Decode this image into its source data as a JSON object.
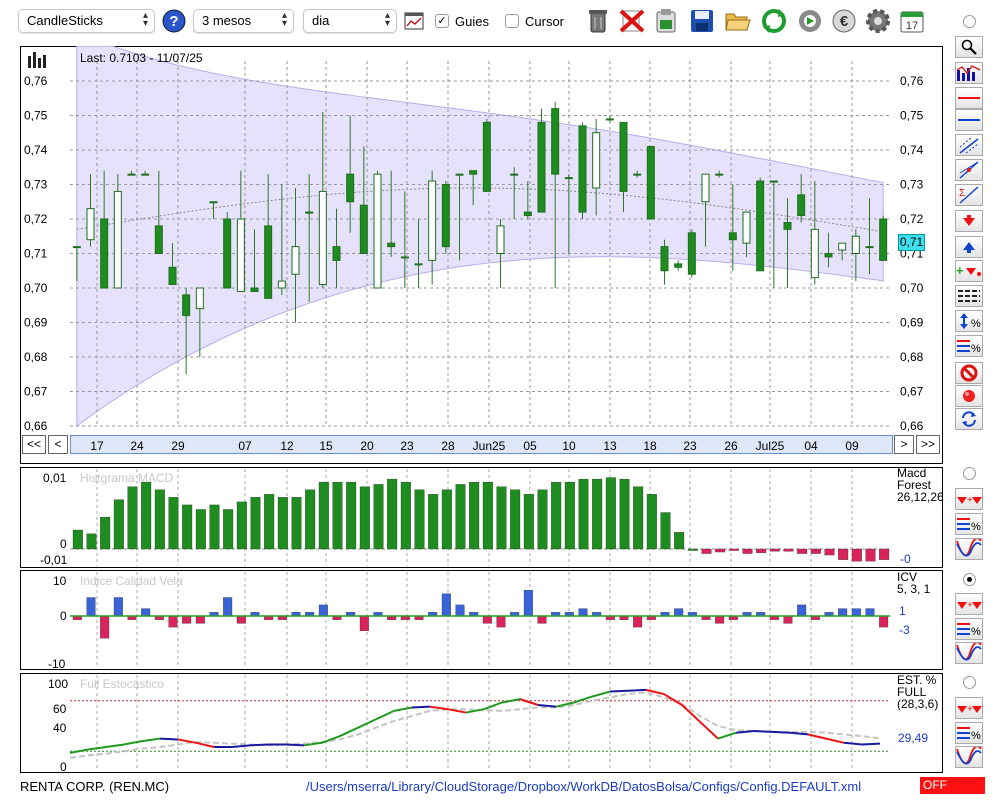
{
  "toolbar": {
    "chart_type": "CandleSticks",
    "period": "3 mesos",
    "interval": "dia",
    "guides_label": "Guies",
    "guides_checked": true,
    "cursor_label": "Cursor",
    "cursor_checked": false,
    "icons": [
      "help-icon",
      "chart-window-icon",
      "trash-icon",
      "delete-red-x-icon",
      "clipboard-icon",
      "save-disk-icon",
      "open-folder-icon",
      "refresh-icon",
      "world-refresh-icon",
      "euro-icon",
      "gear-icon",
      "calendar-icon"
    ],
    "calendar_day": "17"
  },
  "main": {
    "last_label": "Last: 0.7103 - 11/07/25",
    "price_tag": "0,71",
    "y_ticks": [
      "0,76",
      "0,75",
      "0,74",
      "0,73",
      "0,72",
      "0,71",
      "0,70",
      "0,69",
      "0,68",
      "0,67",
      "0,66"
    ],
    "x_ticks": [
      "17",
      "24",
      "29",
      "07",
      "12",
      "15",
      "20",
      "23",
      "28",
      "Jun25",
      "05",
      "10",
      "13",
      "18",
      "23",
      "26",
      "Jul25",
      "04",
      "09"
    ],
    "nav": {
      "first": "<<",
      "prev": "<",
      "next": ">",
      "last": ">>"
    }
  },
  "macd": {
    "title": "Histgrama MACD",
    "y_ticks": [
      "0,01",
      "0",
      "-0,01"
    ],
    "legend": [
      "Macd",
      "Forest",
      "26,12,26"
    ],
    "value": "-0"
  },
  "icv": {
    "title": "Indice Calidad Vela",
    "y_ticks": [
      "10",
      "0",
      "-10"
    ],
    "legend": [
      "ICV",
      "5, 3, 1"
    ],
    "values": [
      "1",
      "-3"
    ]
  },
  "stoch": {
    "title": "Full Estocástico",
    "y_ticks": [
      "100",
      "60",
      "40",
      "0"
    ],
    "legend": [
      "EST. %",
      "FULL",
      "(28,3,6)"
    ],
    "value": "29,49"
  },
  "status": {
    "company": "RENTA CORP. (REN.MC)",
    "path": "/Users/mserra/Library/CloudStorage/Dropbox/WorkDB/DatosBolsa/Configs/Config.DEFAULT.xml",
    "badge": "OFF"
  },
  "colors": {
    "up": "#ffffff",
    "down": "#1f8c1f",
    "band": "#e3ddfa",
    "macd_pos": "#1f8c1f",
    "macd_neg": "#d8245a",
    "icv_pos": "#3a63d8",
    "icv_neg": "#d8245a",
    "badge_bg": "#f11"
  },
  "chart_data": [
    {
      "type": "candlestick",
      "y_ticks": [
        0.76,
        0.75,
        0.74,
        0.73,
        0.72,
        0.71,
        0.7,
        0.69,
        0.68,
        0.67,
        0.66
      ],
      "ylim": [
        0.66,
        0.765
      ],
      "x_ticks": [
        "17",
        "24",
        "29",
        "07",
        "12",
        "15",
        "20",
        "23",
        "28",
        "Jun25",
        "05",
        "10",
        "13",
        "18",
        "23",
        "26",
        "Jul25",
        "04",
        "09"
      ],
      "ohlc": [
        [
          0.712,
          0.712,
          0.702,
          0.712
        ],
        [
          0.714,
          0.733,
          0.712,
          0.723
        ],
        [
          0.72,
          0.734,
          0.704,
          0.7
        ],
        [
          0.7,
          0.733,
          0.71,
          0.728
        ],
        [
          0.733,
          0.734,
          0.733,
          0.733
        ],
        [
          0.733,
          0.734,
          0.733,
          0.733
        ],
        [
          0.718,
          0.734,
          0.71,
          0.71
        ],
        [
          0.706,
          0.713,
          0.701,
          0.701
        ],
        [
          0.698,
          0.7,
          0.675,
          0.692
        ],
        [
          0.694,
          0.7,
          0.68,
          0.7
        ],
        [
          0.725,
          0.725,
          0.72,
          0.725
        ],
        [
          0.72,
          0.722,
          0.7,
          0.7
        ],
        [
          0.699,
          0.734,
          0.699,
          0.72
        ],
        [
          0.7,
          0.717,
          0.699,
          0.699
        ],
        [
          0.718,
          0.733,
          0.698,
          0.697
        ],
        [
          0.7,
          0.73,
          0.698,
          0.702
        ],
        [
          0.704,
          0.729,
          0.69,
          0.712
        ],
        [
          0.722,
          0.733,
          0.696,
          0.722
        ],
        [
          0.701,
          0.751,
          0.7,
          0.728
        ],
        [
          0.712,
          0.723,
          0.7,
          0.708
        ],
        [
          0.733,
          0.75,
          0.716,
          0.725
        ],
        [
          0.724,
          0.741,
          0.716,
          0.71
        ],
        [
          0.7,
          0.734,
          0.706,
          0.733
        ],
        [
          0.713,
          0.734,
          0.709,
          0.712
        ],
        [
          0.709,
          0.728,
          0.7,
          0.709
        ],
        [
          0.707,
          0.72,
          0.7,
          0.707
        ],
        [
          0.708,
          0.734,
          0.701,
          0.731
        ],
        [
          0.73,
          0.731,
          0.71,
          0.712
        ],
        [
          0.733,
          0.733,
          0.708,
          0.733
        ],
        [
          0.734,
          0.734,
          0.724,
          0.733
        ],
        [
          0.748,
          0.749,
          0.728,
          0.728
        ],
        [
          0.71,
          0.72,
          0.7,
          0.718
        ],
        [
          0.733,
          0.735,
          0.72,
          0.733
        ],
        [
          0.722,
          0.731,
          0.72,
          0.721
        ],
        [
          0.748,
          0.752,
          0.722,
          0.722
        ],
        [
          0.752,
          0.754,
          0.7,
          0.733
        ],
        [
          0.732,
          0.733,
          0.71,
          0.732
        ],
        [
          0.747,
          0.748,
          0.72,
          0.722
        ],
        [
          0.729,
          0.749,
          0.721,
          0.745
        ],
        [
          0.749,
          0.75,
          0.748,
          0.749
        ],
        [
          0.748,
          0.748,
          0.722,
          0.728
        ],
        [
          0.733,
          0.734,
          0.732,
          0.733
        ],
        [
          0.741,
          0.741,
          0.72,
          0.72
        ],
        [
          0.712,
          0.714,
          0.701,
          0.705
        ],
        [
          0.707,
          0.708,
          0.705,
          0.706
        ],
        [
          0.716,
          0.717,
          0.703,
          0.704
        ],
        [
          0.725,
          0.733,
          0.712,
          0.733
        ],
        [
          0.733,
          0.734,
          0.732,
          0.733
        ],
        [
          0.716,
          0.73,
          0.705,
          0.714
        ],
        [
          0.713,
          0.721,
          0.709,
          0.722
        ],
        [
          0.731,
          0.732,
          0.705,
          0.705
        ],
        [
          0.731,
          0.731,
          0.7,
          0.731
        ],
        [
          0.719,
          0.726,
          0.7,
          0.717
        ],
        [
          0.727,
          0.733,
          0.719,
          0.721
        ],
        [
          0.703,
          0.731,
          0.701,
          0.717
        ],
        [
          0.71,
          0.716,
          0.706,
          0.709
        ],
        [
          0.711,
          0.713,
          0.708,
          0.713
        ],
        [
          0.71,
          0.717,
          0.702,
          0.715
        ],
        [
          0.712,
          0.726,
          0.704,
          0.712
        ],
        [
          0.72,
          0.721,
          0.708,
          0.708
        ]
      ]
    },
    {
      "type": "bar",
      "title": "Histgrama MACD",
      "ylim": [
        -0.01,
        0.01
      ],
      "values": [
        0.0025,
        0.002,
        0.0042,
        0.0065,
        0.0082,
        0.0088,
        0.0078,
        0.0068,
        0.0058,
        0.0052,
        0.0058,
        0.0052,
        0.0062,
        0.0068,
        0.0072,
        0.0068,
        0.0068,
        0.0078,
        0.0088,
        0.0088,
        0.0088,
        0.0082,
        0.0085,
        0.0092,
        0.0088,
        0.0078,
        0.0072,
        0.0078,
        0.0085,
        0.0088,
        0.0088,
        0.0082,
        0.0078,
        0.0072,
        0.0078,
        0.0088,
        0.0088,
        0.0092,
        0.0092,
        0.0094,
        0.0092,
        0.0082,
        0.0072,
        0.0048,
        0.0022,
        0.0,
        -0.0006,
        -0.0004,
        -0.0002,
        -0.0006,
        -0.0005,
        -0.0003,
        -0.0003,
        -0.0006,
        -0.0006,
        -0.0008,
        -0.0014,
        -0.0016,
        -0.0016,
        -0.0014
      ]
    },
    {
      "type": "bar",
      "title": "Indice Calidad Vela",
      "ylim": [
        -10,
        10
      ],
      "values": [
        -1,
        5,
        -6,
        5,
        -1,
        2,
        -1,
        -3,
        -2,
        -2,
        1,
        5,
        -2,
        1,
        -1,
        -1,
        1,
        1,
        3,
        -1,
        1,
        -4,
        1,
        -1,
        -1,
        -1,
        1,
        6,
        3,
        1,
        -2,
        -3,
        1,
        7,
        -2,
        1,
        1,
        2,
        1,
        -1,
        -1,
        -3,
        -1,
        1,
        2,
        1,
        -1,
        -2,
        -1,
        1,
        1,
        -1,
        -2,
        3,
        -1,
        1,
        2,
        2,
        2,
        -3
      ]
    },
    {
      "type": "line",
      "title": "Full Estocástico",
      "ylim": [
        0,
        100
      ],
      "series": [
        {
          "values": [
            18,
            22,
            25,
            28,
            32,
            35,
            34,
            30,
            25,
            25,
            27,
            28,
            28,
            27,
            30,
            38,
            48,
            58,
            68,
            72,
            73,
            70,
            66,
            70,
            78,
            82,
            75,
            73,
            78,
            85,
            91,
            92,
            93,
            88,
            75,
            55,
            35,
            42,
            44,
            43,
            42,
            40,
            35,
            30,
            28,
            29
          ]
        },
        {
          "values": [
            12,
            15,
            17,
            20,
            23,
            25,
            28,
            31,
            30,
            29,
            28,
            27,
            28,
            29,
            31,
            34,
            40,
            48,
            56,
            62,
            68,
            70,
            70,
            69,
            68,
            70,
            72,
            72,
            75,
            80,
            84,
            88,
            90,
            84,
            76,
            62,
            50,
            45,
            44,
            43,
            43,
            43,
            42,
            40,
            38,
            35
          ]
        }
      ]
    }
  ]
}
